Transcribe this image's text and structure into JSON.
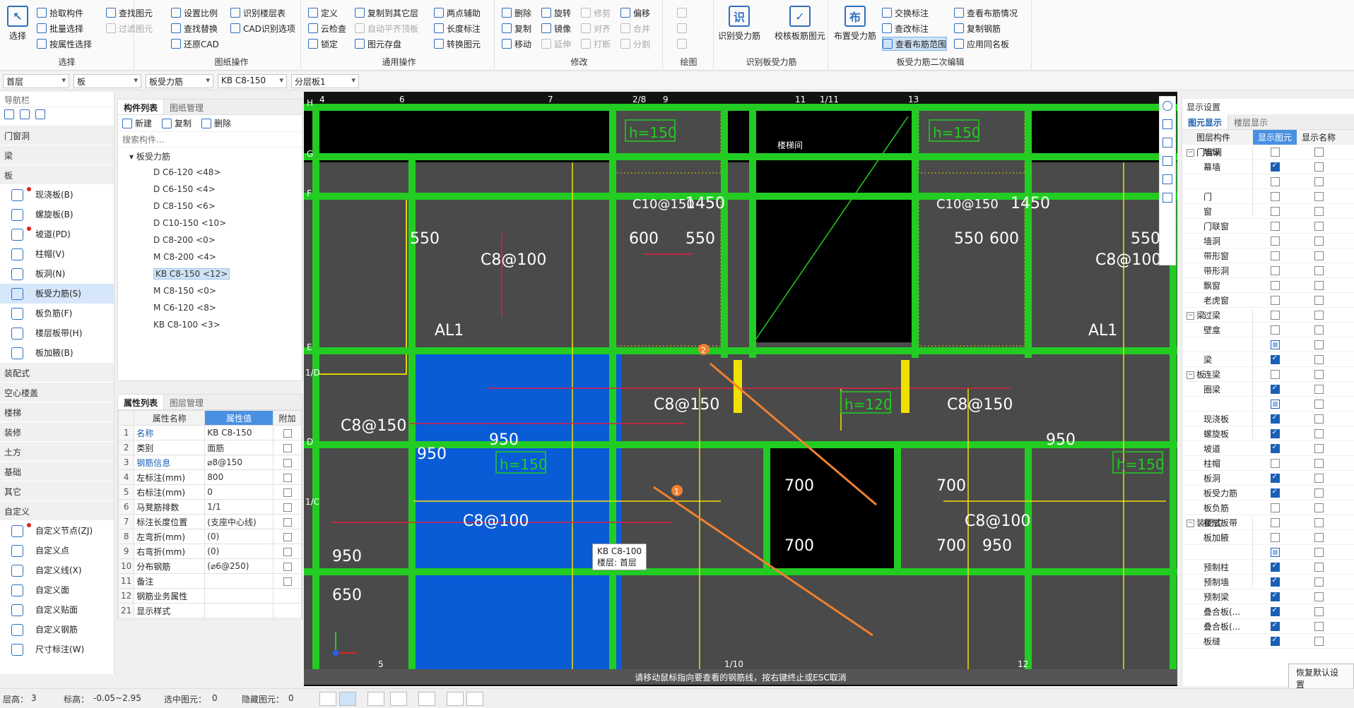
{
  "ribbon": {
    "select_group": {
      "title": "选择",
      "select": "选择",
      "pick": "拾取构件",
      "batch": "批量选择",
      "by_attr": "按属性选择",
      "find": "查找图元",
      "filter": "过滤图元"
    },
    "drawing_group": {
      "title": "图纸操作",
      "set_scale": "设置比例",
      "recog_floor": "识别楼层表",
      "find_replace": "查找替换",
      "cad_opts": "CAD识别选项",
      "restore_cad": "还原CAD"
    },
    "common_group": {
      "title": "通用操作",
      "define": "定义",
      "copy_floor": "复制到其它层",
      "two_points": "两点辅助",
      "cloud_check": "云检查",
      "auto_flat": "自动平齐顶板",
      "length_mark": "长度标注",
      "lock": "锁定",
      "elem_save": "图元存盘",
      "convert": "转换图元"
    },
    "modify_group": {
      "title": "修改",
      "delete": "删除",
      "rotate": "旋转",
      "trim": "修剪",
      "offset": "偏移",
      "copy": "复制",
      "mirror": "镜像",
      "align": "对齐",
      "merge": "合并",
      "move": "移动",
      "extend": "延伸",
      "break": "打断",
      "split": "分割"
    },
    "draw_group": {
      "title": "绘图"
    },
    "recog_group": {
      "title": "识别板受力筋",
      "recog_rebar": "识别受力筋",
      "check_rebar": "校核板筋图元"
    },
    "edit_group": {
      "title": "板受力筋二次编辑",
      "place": "布置受力筋",
      "swap_mark": "交换标注",
      "change_mark": "查改标注",
      "view_range": "查看布筋范围",
      "view_layout": "查看布筋情况",
      "copy_rebar": "复制钢筋",
      "apply_same": "应用同名板"
    }
  },
  "dropdowns": [
    "首层",
    "板",
    "板受力筋",
    "KB C8-150",
    "分层板1"
  ],
  "nav": {
    "title": "导航栏",
    "categories": [
      "门窗洞",
      "梁",
      "板"
    ],
    "items": [
      "现浇板(B)",
      "螺旋板(B)",
      "坡道(PD)",
      "柱帽(V)",
      "板洞(N)",
      "板受力筋(S)",
      "板负筋(F)",
      "楼层板带(H)",
      "板加腋(B)"
    ],
    "categories2": [
      "装配式",
      "空心楼盖",
      "楼梯",
      "装修",
      "土方",
      "基础",
      "其它",
      "自定义"
    ],
    "custom_items": [
      "自定义节点(ZJ)",
      "自定义点",
      "自定义线(X)",
      "自定义面",
      "自定义贴面",
      "自定义钢筋",
      "尺寸标注(W)"
    ]
  },
  "clist": {
    "tab1": "构件列表",
    "tab2": "图纸管理",
    "new": "新建",
    "copy": "复制",
    "delete": "删除",
    "search_placeholder": "搜索构件...",
    "root": "板受力筋",
    "items": [
      "D C6-120 <48>",
      "D C6-150 <4>",
      "D C8-150 <6>",
      "D C10-150 <10>",
      "D C8-200 <0>",
      "M C8-200 <4>",
      "KB C8-150 <12>",
      "M C8-150 <0>",
      "M C6-120 <8>",
      "KB C8-100 <3>"
    ]
  },
  "props": {
    "tab1": "属性列表",
    "tab2": "图层管理",
    "headers": [
      "属性名称",
      "属性值",
      "附加"
    ],
    "rows": [
      {
        "n": "1",
        "name": "名称",
        "val": "KB C8-150",
        "blue": true
      },
      {
        "n": "2",
        "name": "类别",
        "val": "面筋"
      },
      {
        "n": "3",
        "name": "钢筋信息",
        "val": "⌀8@150",
        "blue": true
      },
      {
        "n": "4",
        "name": "左标注(mm)",
        "val": "800"
      },
      {
        "n": "5",
        "name": "右标注(mm)",
        "val": "0"
      },
      {
        "n": "6",
        "name": "马凳筋排数",
        "val": "1/1"
      },
      {
        "n": "7",
        "name": "标注长度位置",
        "val": "(支座中心线)"
      },
      {
        "n": "8",
        "name": "左弯折(mm)",
        "val": "(0)"
      },
      {
        "n": "9",
        "name": "右弯折(mm)",
        "val": "(0)"
      },
      {
        "n": "10",
        "name": "分布钢筋",
        "val": "(⌀6@250)"
      },
      {
        "n": "11",
        "name": "备注",
        "val": ""
      },
      {
        "n": "12",
        "name": "钢筋业务属性",
        "val": ""
      },
      {
        "n": "21",
        "name": "显示样式",
        "val": ""
      }
    ]
  },
  "canvas": {
    "axis_top": [
      "4",
      "6",
      "7",
      "2/8",
      "9",
      "11",
      "1/11",
      "13"
    ],
    "axis_left": [
      "H",
      "G",
      "F",
      "E",
      "1/D",
      "D",
      "1/C"
    ],
    "labels": {
      "c8_100": "C8@100",
      "c8_150": "C8@150",
      "al1": "AL1",
      "h150": "h=150",
      "h120": "h=120",
      "n950": "950",
      "n550": "550",
      "n600": "600",
      "n700": "700",
      "n1450": "1450",
      "n650": "650",
      "c10": "C10@150",
      "stair": "楼梯间"
    },
    "tooltip_name": "KB C8-100",
    "tooltip_floor": "楼层: 首层",
    "badge1": "1",
    "badge2": "2",
    "status": "请移动鼠标指向要查看的钢筋线，按右键终止或ESC取消",
    "bottom_axis": [
      "5",
      "1/10",
      "12"
    ]
  },
  "rpanel": {
    "title": "显示设置",
    "tab1": "图元显示",
    "tab2": "楼层显示",
    "headers": [
      "图层构件",
      "显示图元",
      "显示名称"
    ],
    "rows": [
      {
        "name": "墙垛",
        "a": "off",
        "b": "off",
        "g": false
      },
      {
        "name": "幕墙",
        "a": "on",
        "b": "off",
        "g": false
      },
      {
        "name": "门窗洞",
        "a": "off",
        "b": "off",
        "g": true
      },
      {
        "name": "门",
        "a": "off",
        "b": "off",
        "g": false
      },
      {
        "name": "窗",
        "a": "off",
        "b": "off",
        "g": false
      },
      {
        "name": "门联窗",
        "a": "off",
        "b": "off",
        "g": false
      },
      {
        "name": "墙洞",
        "a": "off",
        "b": "off",
        "g": false
      },
      {
        "name": "带形窗",
        "a": "off",
        "b": "off",
        "g": false
      },
      {
        "name": "带形洞",
        "a": "off",
        "b": "off",
        "g": false
      },
      {
        "name": "飘窗",
        "a": "off",
        "b": "off",
        "g": false
      },
      {
        "name": "老虎窗",
        "a": "off",
        "b": "off",
        "g": false
      },
      {
        "name": "过梁",
        "a": "off",
        "b": "off",
        "g": false
      },
      {
        "name": "壁龛",
        "a": "off",
        "b": "off",
        "g": false
      },
      {
        "name": "梁",
        "a": "part",
        "b": "off",
        "g": true
      },
      {
        "name": "梁",
        "a": "on",
        "b": "off",
        "g": false
      },
      {
        "name": "连梁",
        "a": "off",
        "b": "off",
        "g": false
      },
      {
        "name": "圈梁",
        "a": "on",
        "b": "off",
        "g": false
      },
      {
        "name": "板",
        "a": "part",
        "b": "off",
        "g": true
      },
      {
        "name": "现浇板",
        "a": "on",
        "b": "off",
        "g": false
      },
      {
        "name": "螺旋板",
        "a": "on",
        "b": "off",
        "g": false
      },
      {
        "name": "坡道",
        "a": "on",
        "b": "off",
        "g": false
      },
      {
        "name": "柱帽",
        "a": "off",
        "b": "off",
        "g": false
      },
      {
        "name": "板洞",
        "a": "on",
        "b": "off",
        "g": false
      },
      {
        "name": "板受力筋",
        "a": "on",
        "b": "off",
        "g": false
      },
      {
        "name": "板负筋",
        "a": "off",
        "b": "off",
        "g": false
      },
      {
        "name": "楼层板带",
        "a": "off",
        "b": "off",
        "g": false
      },
      {
        "name": "板加腋",
        "a": "off",
        "b": "off",
        "g": false
      },
      {
        "name": "装配式",
        "a": "part",
        "b": "off",
        "g": true
      },
      {
        "name": "预制柱",
        "a": "on",
        "b": "off",
        "g": false
      },
      {
        "name": "预制墙",
        "a": "on",
        "b": "off",
        "g": false
      },
      {
        "name": "预制梁",
        "a": "on",
        "b": "off",
        "g": false
      },
      {
        "name": "叠合板(...",
        "a": "on",
        "b": "off",
        "g": false
      },
      {
        "name": "叠合板(...",
        "a": "on",
        "b": "off",
        "g": false
      },
      {
        "name": "板缝",
        "a": "on",
        "b": "off",
        "g": false
      }
    ],
    "reset": "恢复默认设置"
  },
  "status": {
    "floor": "层高：",
    "floor_val": "3",
    "elev": "标高：",
    "elev_val": "-0.05~2.95",
    "sel": "选中图元：",
    "sel_val": "0",
    "hidden": "隐藏图元：",
    "hidden_val": "0"
  }
}
